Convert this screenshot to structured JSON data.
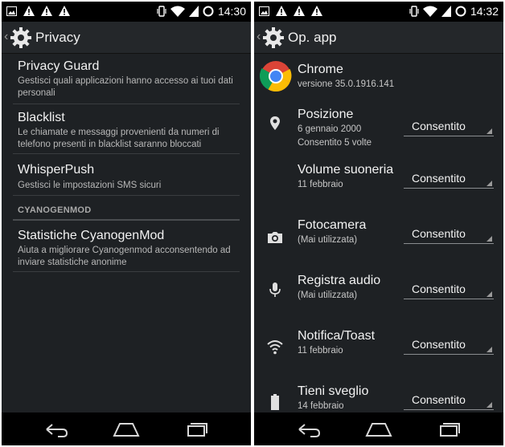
{
  "left": {
    "status_time": "14:30",
    "title": "Privacy",
    "prefs": [
      {
        "title": "Privacy Guard",
        "summary": "Gestisci quali applicazioni hanno accesso ai tuoi dati personali"
      },
      {
        "title": "Blacklist",
        "summary": "Le chiamate e messaggi provenienti da numeri di telefono presenti in blacklist saranno bloccati"
      },
      {
        "title": "WhisperPush",
        "summary": "Gestisci le impostazioni SMS sicuri"
      }
    ],
    "category": "CYANOGENMOD",
    "cm_pref": {
      "title": "Statistiche CyanogenMod",
      "summary": "Aiuta a migliorare Cyanogenmod acconsentendo ad inviare statistiche anonime"
    }
  },
  "right": {
    "status_time": "14:32",
    "title": "Op. app",
    "app": {
      "name": "Chrome",
      "version": "versione 35.0.1916.141"
    },
    "ops": [
      {
        "title": "Posizione",
        "line1": "6 gennaio 2000",
        "line2": "Consentito 5 volte",
        "value": "Consentito",
        "icon": "location-icon"
      },
      {
        "title": "Volume suoneria",
        "line1": "11 febbraio",
        "line2": "",
        "value": "Consentito",
        "icon": ""
      },
      {
        "title": "Fotocamera",
        "line1": "(Mai utilizzata)",
        "line2": "",
        "value": "Consentito",
        "icon": "camera-icon"
      },
      {
        "title": "Registra audio",
        "line1": "(Mai utilizzata)",
        "line2": "",
        "value": "Consentito",
        "icon": "microphone-icon"
      },
      {
        "title": "Notifica/Toast",
        "line1": "11 febbraio",
        "line2": "",
        "value": "Consentito",
        "icon": "wifi-icon"
      },
      {
        "title": "Tieni sveglio",
        "line1": "14 febbraio",
        "line2": "",
        "value": "Consentito",
        "icon": "battery-icon"
      }
    ]
  },
  "colors": {
    "background": "#1e2124",
    "actionbar": "#24272a",
    "statusbar": "#000000"
  }
}
